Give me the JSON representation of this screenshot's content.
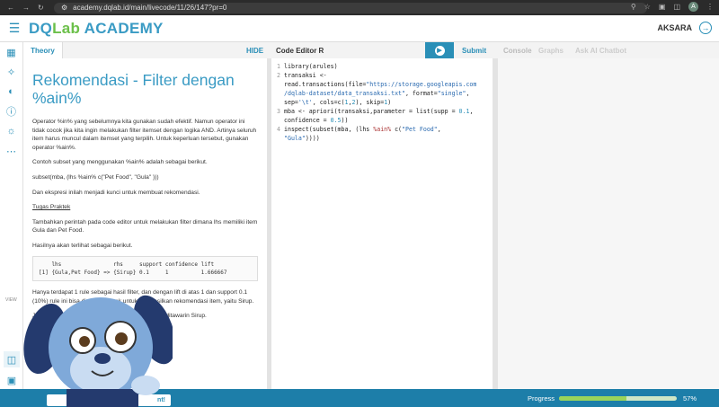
{
  "browser": {
    "url": "academy.dqlab.id/main/livecode/11/26/147?pr=0",
    "profile_initial": "A"
  },
  "app": {
    "logo_dq": "DQ",
    "logo_lab": "Lab",
    "logo_academy": "ACADEMY",
    "username": "AKSARA"
  },
  "toolbar": {
    "theory_tab": "Theory",
    "hide": "HIDE",
    "editor_title": "Code Editor R",
    "submit": "Submit",
    "console": "Console",
    "graphs": "Graphs",
    "chatbot": "Ask AI Chatbot"
  },
  "rail": {
    "view_label": "VIEW"
  },
  "theory": {
    "title": "Rekomendasi - Filter dengan %ain%",
    "p1": "Operator %in% yang sebelumnya kita gunakan sudah efektif. Namun operator ini tidak cocok jika kita ingin melakukan filter itemset dengan logika AND. Artinya seluruh item harus muncul dalam itemset yang terpilih. Untuk keperluan tersebut, gunakan operator %ain%.",
    "p2": "Contoh subset yang menggunakan %ain% adalah sebagai berikut.",
    "p3": "subset(mba, (lhs %ain% c(\"Pet Food\", \"Gula\" )))",
    "p4": "Dan ekspresi inilah menjadi kunci untuk membuat rekomendasi.",
    "task_heading": "Tugas Praktek",
    "p5": "Tambahkan perintah pada code editor untuk melakukan filter dimana lhs memiliki item Gula dan Pet Food.",
    "p6": "Hasilnya akan terlihat sebagai berikut.",
    "output_header": "    lhs                rhs     support confidence lift",
    "output_row": "[1] {Gula,Pet Food} => {Sirup} 0.1     1          1.666667",
    "p7": "Hanya terdapat 1 rule sebagai hasil filter, dan dengan lift di atas 1 dan support 0.1 (10%) rule ini bisa dianggap layak untuk meghasilkan rekomendasi item, yaitu Sirup.",
    "p8": "Jadi orang yang membeli Gula dan Pet Food, bisa ditawarin Sirup."
  },
  "code": {
    "line_numbers": [
      "1",
      "2",
      "3",
      "4"
    ],
    "l1": "library(arules)",
    "l2a": "transaksi <-",
    "l2b": "read.transactions(file=",
    "l2c": "\"https://storage.googleapis.com",
    "l2d": "/dqlab-dataset/data_transaksi.txt\"",
    "l2e": ", format=",
    "l2f": "\"single\"",
    "l2g": ",",
    "l2h": "sep=",
    "l2i": "'\\t'",
    "l2j": ", cols=c(",
    "l2k": "1",
    "l2l": ",",
    "l2m": "2",
    "l2n": "), skip=",
    "l2o": "1",
    "l2p": ")",
    "l3a": "mba <- apriori(transaksi,parameter = list(supp = ",
    "l3b": "0.1",
    "l3c": ",",
    "l3d": "confidence = ",
    "l3e": "0.5",
    "l3f": "))",
    "l4a": "inspect(subset(mba, (lhs ",
    "l4b": "%ain%",
    "l4c": " c(",
    "l4d": "\"Pet Food\"",
    "l4e": ",",
    "l4f": "\"Gula\"",
    "l4g": "))))"
  },
  "footer": {
    "bottom_button": "nt!",
    "progress_label": "Progress",
    "progress_pct": "57%",
    "progress_value": 0.57
  }
}
